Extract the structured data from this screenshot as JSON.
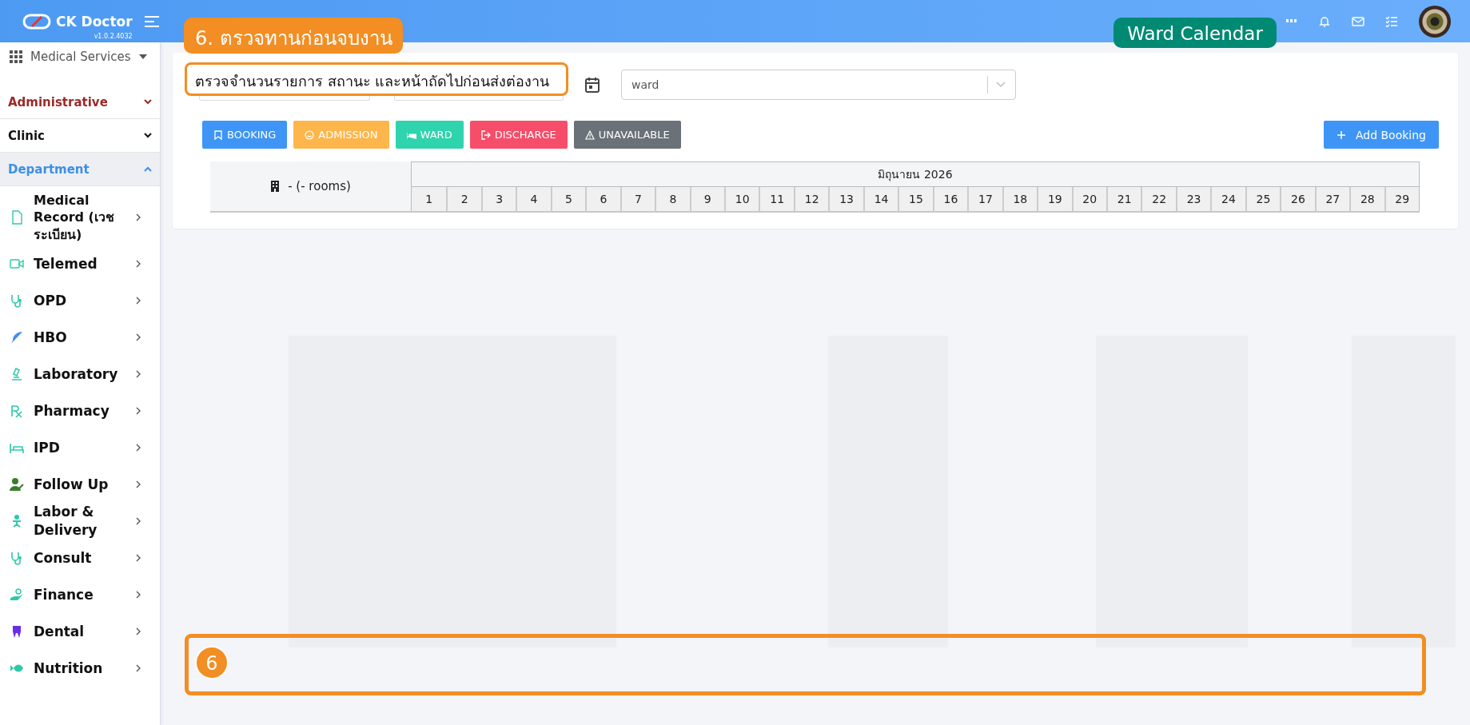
{
  "app": {
    "name": "CK Doctor",
    "version": "v1.0.2.4032"
  },
  "module_menu": {
    "label": "Medical Services"
  },
  "sections": [
    {
      "label": "Administrative",
      "expanded": false,
      "color": "#9b2a2a"
    },
    {
      "label": "Clinic",
      "expanded": false,
      "color": "#111111"
    },
    {
      "label": "Department",
      "expanded": true,
      "color": "#3d8fe6"
    }
  ],
  "menu_items": [
    {
      "label": "Medical Record (เวชระเบียน)",
      "kind": "file"
    },
    {
      "label": "Telemed",
      "kind": "video"
    },
    {
      "label": "OPD",
      "kind": "stethoscope"
    },
    {
      "label": "HBO",
      "kind": "feather"
    },
    {
      "label": "Laboratory",
      "kind": "microscope"
    },
    {
      "label": "Pharmacy",
      "kind": "rx"
    },
    {
      "label": "IPD",
      "kind": "bed"
    },
    {
      "label": "Follow Up",
      "kind": "user"
    },
    {
      "label": "Labor & Delivery",
      "kind": "baby"
    },
    {
      "label": "Consult",
      "kind": "stethoscope"
    },
    {
      "label": "Finance",
      "kind": "hand"
    },
    {
      "label": "Dental",
      "kind": "tooth"
    },
    {
      "label": "Nutrition",
      "kind": "fish"
    }
  ],
  "filters": {
    "ward_select": {
      "placeholder": "ward"
    }
  },
  "legend_buttons": [
    {
      "label": "BOOKING",
      "kind": "booking"
    },
    {
      "label": "ADMISSION",
      "kind": "admission"
    },
    {
      "label": "WARD",
      "kind": "ward"
    },
    {
      "label": "DISCHARGE",
      "kind": "discharge"
    },
    {
      "label": "UNAVAILABLE",
      "kind": "unavailable"
    }
  ],
  "add_button": {
    "label": "Add Booking"
  },
  "calendar": {
    "room_label": "- (- rooms)",
    "month": "มิถุนายน 2026",
    "days": [
      "1",
      "2",
      "3",
      "4",
      "5",
      "6",
      "7",
      "8",
      "9",
      "10",
      "11",
      "12",
      "13",
      "14",
      "15",
      "16",
      "17",
      "18",
      "19",
      "20",
      "21",
      "22",
      "23",
      "24",
      "25",
      "26",
      "27",
      "28",
      "29"
    ]
  },
  "annotations": {
    "step_label": "6. ตรวจทานก่อนจบงาน",
    "note": "ตรวจจำนวนรายการ สถานะ และหน้าถัดไปก่อนส่งต่องาน",
    "page_label": "Ward Calendar",
    "marker": "6"
  }
}
